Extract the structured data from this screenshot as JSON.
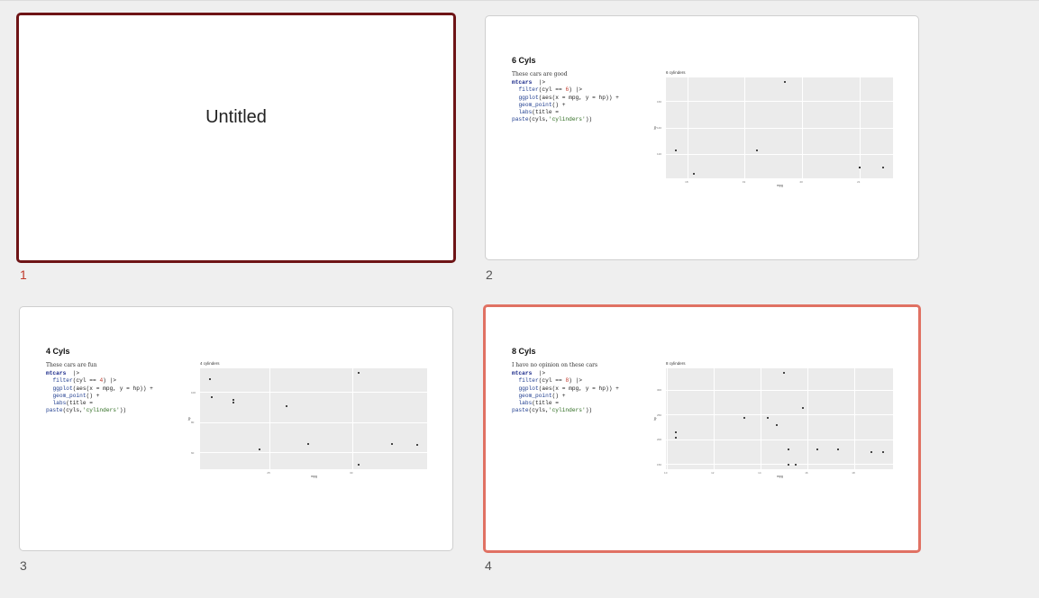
{
  "slides": [
    {
      "number": "1",
      "title": "Untitled",
      "selected": true
    },
    {
      "number": "2",
      "title": "6 Cyls",
      "subtitle": "These cars are good",
      "code": {
        "cyl_value": "6"
      },
      "plot": {
        "title": "6 cylinders",
        "xlabel": "mpg",
        "ylabel": "hp"
      }
    },
    {
      "number": "3",
      "title": "4 Cyls",
      "subtitle": "These cars are fun",
      "code": {
        "cyl_value": "4"
      },
      "plot": {
        "title": "4 cylinders",
        "xlabel": "mpg",
        "ylabel": "hp"
      }
    },
    {
      "number": "4",
      "title": "8 Cyls",
      "subtitle": "I have no opinion on these cars",
      "code": {
        "cyl_value": "8"
      },
      "plot": {
        "title": "8 cylinders",
        "xlabel": "mpg",
        "ylabel": "hp"
      }
    }
  ],
  "code_lines": {
    "l1_obj": "mtcars",
    "pipe": "|>",
    "filter_fn": "filter",
    "filter_open": "(cyl == ",
    "filter_close": ")",
    "ggplot_fn": "ggplot",
    "ggplot_args": "(aes(x = mpg, y = hp)) +",
    "geom_fn": "geom_point",
    "geom_args": "() +",
    "labs_fn": "labs",
    "labs_args": "(title =",
    "paste_fn": "paste",
    "paste_args_open": "(cyls,",
    "paste_str": "'cylinders'",
    "paste_args_close": "))"
  },
  "chart_data": [
    {
      "type": "scatter",
      "title": "6 cylinders",
      "xlabel": "mpg",
      "ylabel": "hp",
      "x": [
        21.0,
        21.0,
        21.4,
        18.1,
        19.2,
        17.8,
        19.7
      ],
      "y": [
        110,
        110,
        110,
        105,
        123,
        123,
        175
      ]
    },
    {
      "type": "scatter",
      "title": "4 cylinders",
      "xlabel": "mpg",
      "ylabel": "hp",
      "x": [
        22.8,
        24.4,
        22.8,
        32.4,
        30.4,
        33.9,
        21.5,
        27.3,
        26.0,
        30.4,
        21.4
      ],
      "y": [
        93,
        62,
        95,
        66,
        52,
        65,
        97,
        66,
        91,
        113,
        109
      ]
    },
    {
      "type": "scatter",
      "title": "8 cylinders",
      "xlabel": "mpg",
      "ylabel": "hp",
      "x": [
        18.7,
        14.3,
        16.4,
        17.3,
        15.2,
        10.4,
        10.4,
        14.7,
        15.5,
        15.2,
        13.3,
        19.2,
        15.8,
        15.0
      ],
      "y": [
        175,
        245,
        180,
        180,
        180,
        205,
        215,
        230,
        150,
        150,
        245,
        175,
        264,
        335
      ]
    }
  ]
}
